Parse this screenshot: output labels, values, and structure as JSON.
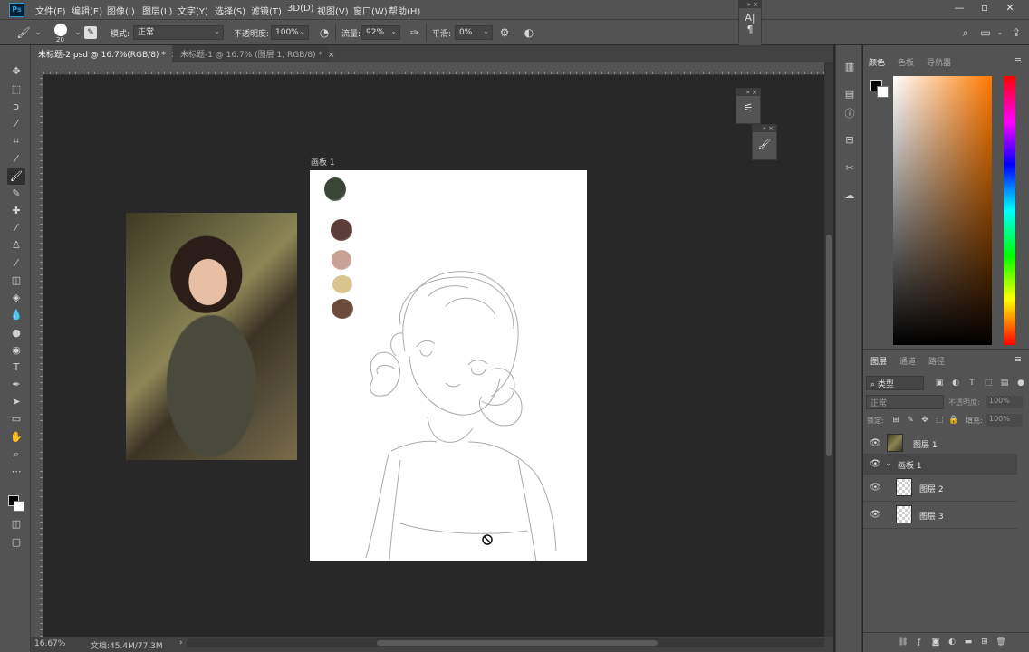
{
  "menu": {
    "logo": "Ps",
    "items": [
      "文件(F)",
      "编辑(E)",
      "图像(I)",
      "图层(L)",
      "文字(Y)",
      "选择(S)",
      "滤镜(T)",
      "3D(D)",
      "视图(V)",
      "窗口(W)",
      "帮助(H)"
    ],
    "window_buttons": [
      "—",
      "▫",
      "✕"
    ]
  },
  "options": {
    "brush_size": "20",
    "mode_label": "模式:",
    "mode_value": "正常",
    "opacity_label": "不透明度:",
    "opacity_value": "100%",
    "flow_label": "流量:",
    "flow_value": "92%",
    "smoothing_label": "平滑:",
    "smoothing_value": "0%"
  },
  "tabs": [
    {
      "label": "未标题-2.psd @ 16.7%(RGB/8) *",
      "close": "×"
    },
    {
      "label": "未标题-1 @ 16.7% (图层 1, RGB/8) *",
      "close": "×"
    }
  ],
  "artboard": {
    "label": "画板 1"
  },
  "swatch_colors": [
    "#3b4638",
    "#5c3d38",
    "#c9a296",
    "#d9c38f",
    "#6b4a3c"
  ],
  "status": {
    "zoom": "16.67%",
    "doc": "文档:45.4M/77.3M",
    "arrow": "›"
  },
  "panels": {
    "color_tabs": [
      "颜色",
      "色板",
      "导航器"
    ],
    "layer_tabs": [
      "图层",
      "通道",
      "路径"
    ],
    "filter_kind": "类型",
    "blend_mode": "正常",
    "opacity_label": "不透明度:",
    "opacity_value": "100%",
    "lock_label": "锁定:",
    "fill_label": "填充:",
    "fill_value": "100%",
    "layers": [
      {
        "name": "图层 1"
      },
      {
        "name": "画板 1"
      },
      {
        "name": "图层 2"
      },
      {
        "name": "图层 3"
      }
    ]
  },
  "colors": {
    "accent": "#2e9bd8",
    "panel_bg": "#535353",
    "canvas_bg": "#282828"
  },
  "icons": [
    "brush-icon",
    "move-icon",
    "marquee-icon",
    "lasso-icon",
    "magic-wand-icon",
    "crop-icon",
    "eyedropper-icon",
    "healing-icon",
    "stamp-icon",
    "eraser-icon",
    "bucket-icon",
    "blur-icon",
    "dodge-icon",
    "pen-icon",
    "type-icon",
    "path-select-icon",
    "shape-icon",
    "hand-icon",
    "zoom-icon",
    "eye-icon",
    "search-icon",
    "workspace-icon",
    "share-icon"
  ]
}
